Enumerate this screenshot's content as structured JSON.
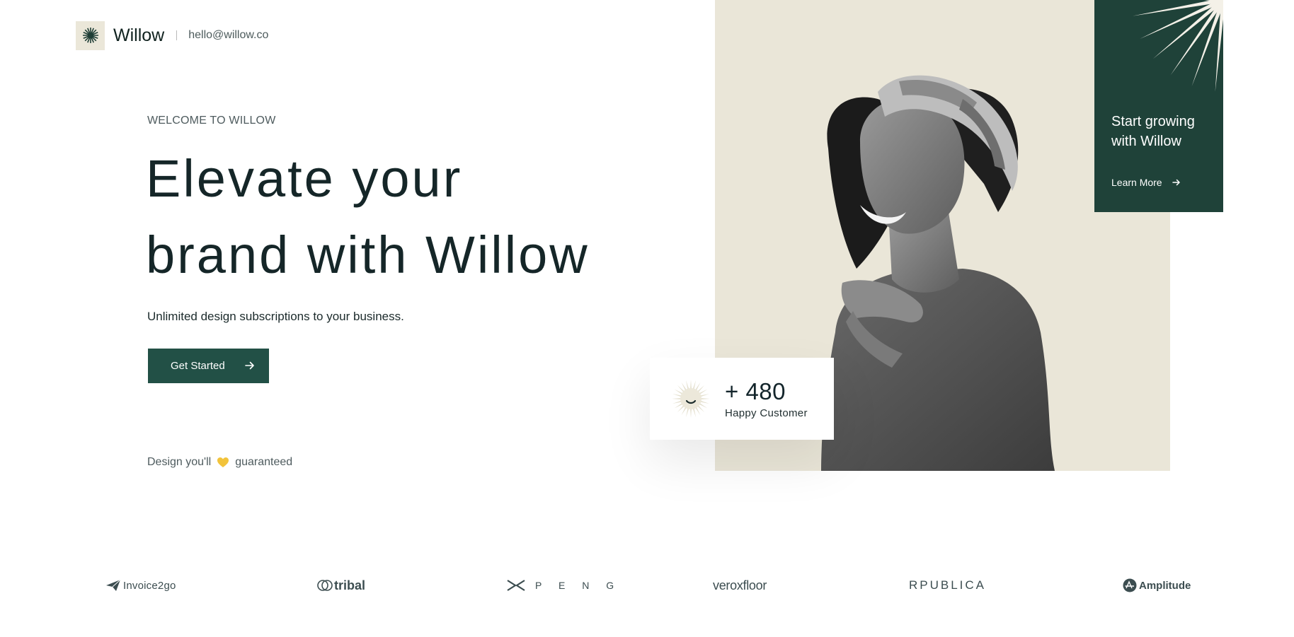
{
  "header": {
    "brand": "Willow",
    "email": "hello@willow.co"
  },
  "hero": {
    "eyebrow": "WELCOME TO WILLOW",
    "headline_line1": "Elevate your",
    "headline_line2": "brand with Willow",
    "subtitle": "Unlimited design subscriptions to your business.",
    "cta_label": "Get Started",
    "guarantee_before": "Design you'll",
    "guarantee_after": "guaranteed"
  },
  "promo": {
    "title": "Start growing with Willow",
    "link_label": "Learn More"
  },
  "stat": {
    "number": "+ 480",
    "label": "Happy Customer"
  },
  "logos": [
    {
      "name": "Invoice2go",
      "icon": "paper-plane-icon"
    },
    {
      "name": "tribal",
      "icon": "tribal-rings-icon"
    },
    {
      "name": "P E N G",
      "icon": "peng-x-icon"
    },
    {
      "name": "veroxfloor",
      "icon": ""
    },
    {
      "name": "RPUBLICA",
      "icon": ""
    },
    {
      "name": "Amplitude",
      "icon": "amplitude-a-icon"
    }
  ],
  "colors": {
    "primary": "#225046",
    "promo": "#1f4239",
    "hero_bg": "#eae6d8",
    "text_dark": "#152628",
    "text_muted": "#4e5b5e",
    "heart": "#f2c33b"
  }
}
